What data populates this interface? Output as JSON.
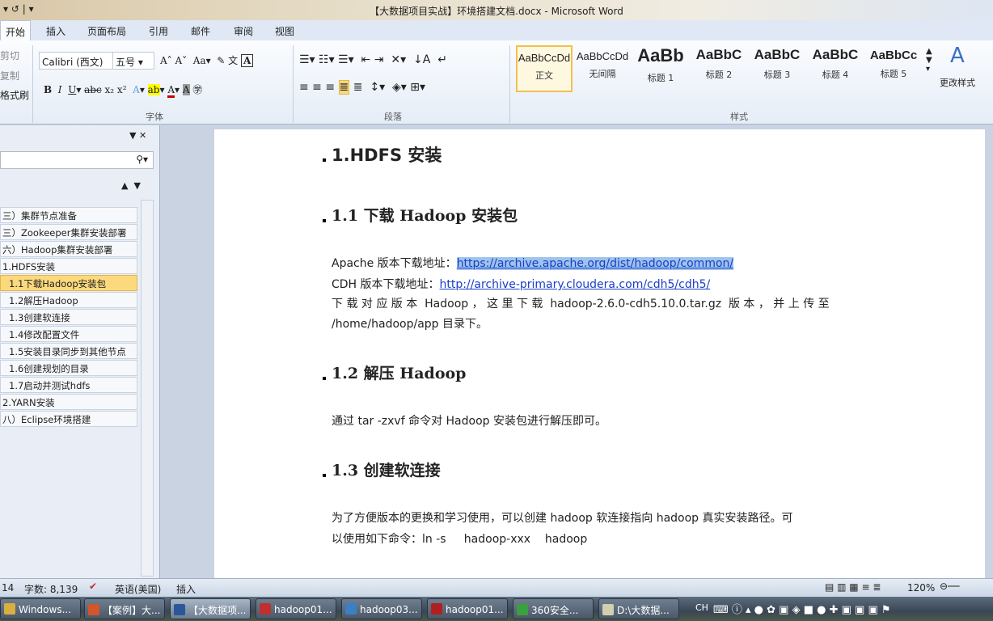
{
  "window": {
    "title": "【大数据项目实战】环境搭建文档.docx - Microsoft Word"
  },
  "tabs": [
    "开始",
    "插入",
    "页面布局",
    "引用",
    "邮件",
    "审阅",
    "视图"
  ],
  "clipboard": {
    "cut": "剪切",
    "copy": "复制",
    "format_painter": "格式刷"
  },
  "font": {
    "name": "Calibri (西文)",
    "size": "五号",
    "group_label": "字体"
  },
  "paragraph": {
    "group_label": "段落"
  },
  "styles": {
    "group_label": "样式",
    "change_styles": "更改样式",
    "items": [
      {
        "preview": "AaBbCcDd",
        "label": "正文"
      },
      {
        "preview": "AaBbCcDd",
        "label": "无间隔"
      },
      {
        "preview": "AaBb",
        "label": "标题 1"
      },
      {
        "preview": "AaBbC",
        "label": "标题 2"
      },
      {
        "preview": "AaBbC",
        "label": "标题 3"
      },
      {
        "preview": "AaBbC",
        "label": "标题 4"
      },
      {
        "preview": "AaBbCc",
        "label": "标题 5"
      }
    ]
  },
  "nav": {
    "items": [
      {
        "label": "三）集群节点准备"
      },
      {
        "label": "三）Zookeeper集群安装部署"
      },
      {
        "label": "六）Hadoop集群安装部署"
      },
      {
        "label": "1.HDFS安装"
      },
      {
        "label": "1.1下载Hadoop安装包",
        "selected": true
      },
      {
        "label": "1.2解压Hadoop"
      },
      {
        "label": "1.3创建软连接"
      },
      {
        "label": "1.4修改配置文件"
      },
      {
        "label": "1.5安装目录同步到其他节点"
      },
      {
        "label": "1.6创建规划的目录"
      },
      {
        "label": "1.7启动并测试hdfs"
      },
      {
        "label": "2.YARN安装"
      },
      {
        "label": "八）Eclipse环境搭建"
      }
    ]
  },
  "doc": {
    "h1": "1.HDFS 安装",
    "h2_1": "1.1 下载 Hadoop 安装包",
    "apache_label": "Apache 版本下载地址：",
    "apache_url": "https://archive.apache.org/dist/hadoop/common/",
    "cdh_label": "CDH 版本下载地址：",
    "cdh_url": "http://archive-primary.cloudera.com/cdh5/cdh5/",
    "p1a": "下 载 对 应 版 本  Hadoop ， 这 里 下 载  hadoop-2.6.0-cdh5.10.0.tar.gz  版 本 ， 并 上 传 至",
    "p1b": "/home/hadoop/app 目录下。",
    "h2_2": "1.2 解压 Hadoop",
    "p2": "通过 tar -zxvf 命令对 Hadoop 安装包进行解压即可。",
    "h2_3": "1.3 创建软连接",
    "p3a": "为了方便版本的更换和学习使用，可以创建 hadoop 软连接指向 hadoop 真实安装路径。可",
    "p3b": "以使用如下命令：ln -s     hadoop-xxx    hadoop"
  },
  "status": {
    "page": "14",
    "words": "字数: 8,139",
    "language": "英语(美国)",
    "mode": "插入",
    "zoom": "120%"
  },
  "taskbar": [
    {
      "label": "Windows...",
      "color": "#d8b040"
    },
    {
      "label": "【案例】大...",
      "color": "#d2552b"
    },
    {
      "label": "【大数据项...",
      "color": "#2b579a",
      "active": true
    },
    {
      "label": "hadoop01...",
      "color": "#c03030"
    },
    {
      "label": "hadoop03...",
      "color": "#3b7fc4"
    },
    {
      "label": "hadoop01...",
      "color": "#b02020"
    },
    {
      "label": "360安全...",
      "color": "#3aa040"
    },
    {
      "label": "D:\\大数据...",
      "color": "#d0d0b0"
    }
  ],
  "tray": {
    "ime": "CH"
  }
}
